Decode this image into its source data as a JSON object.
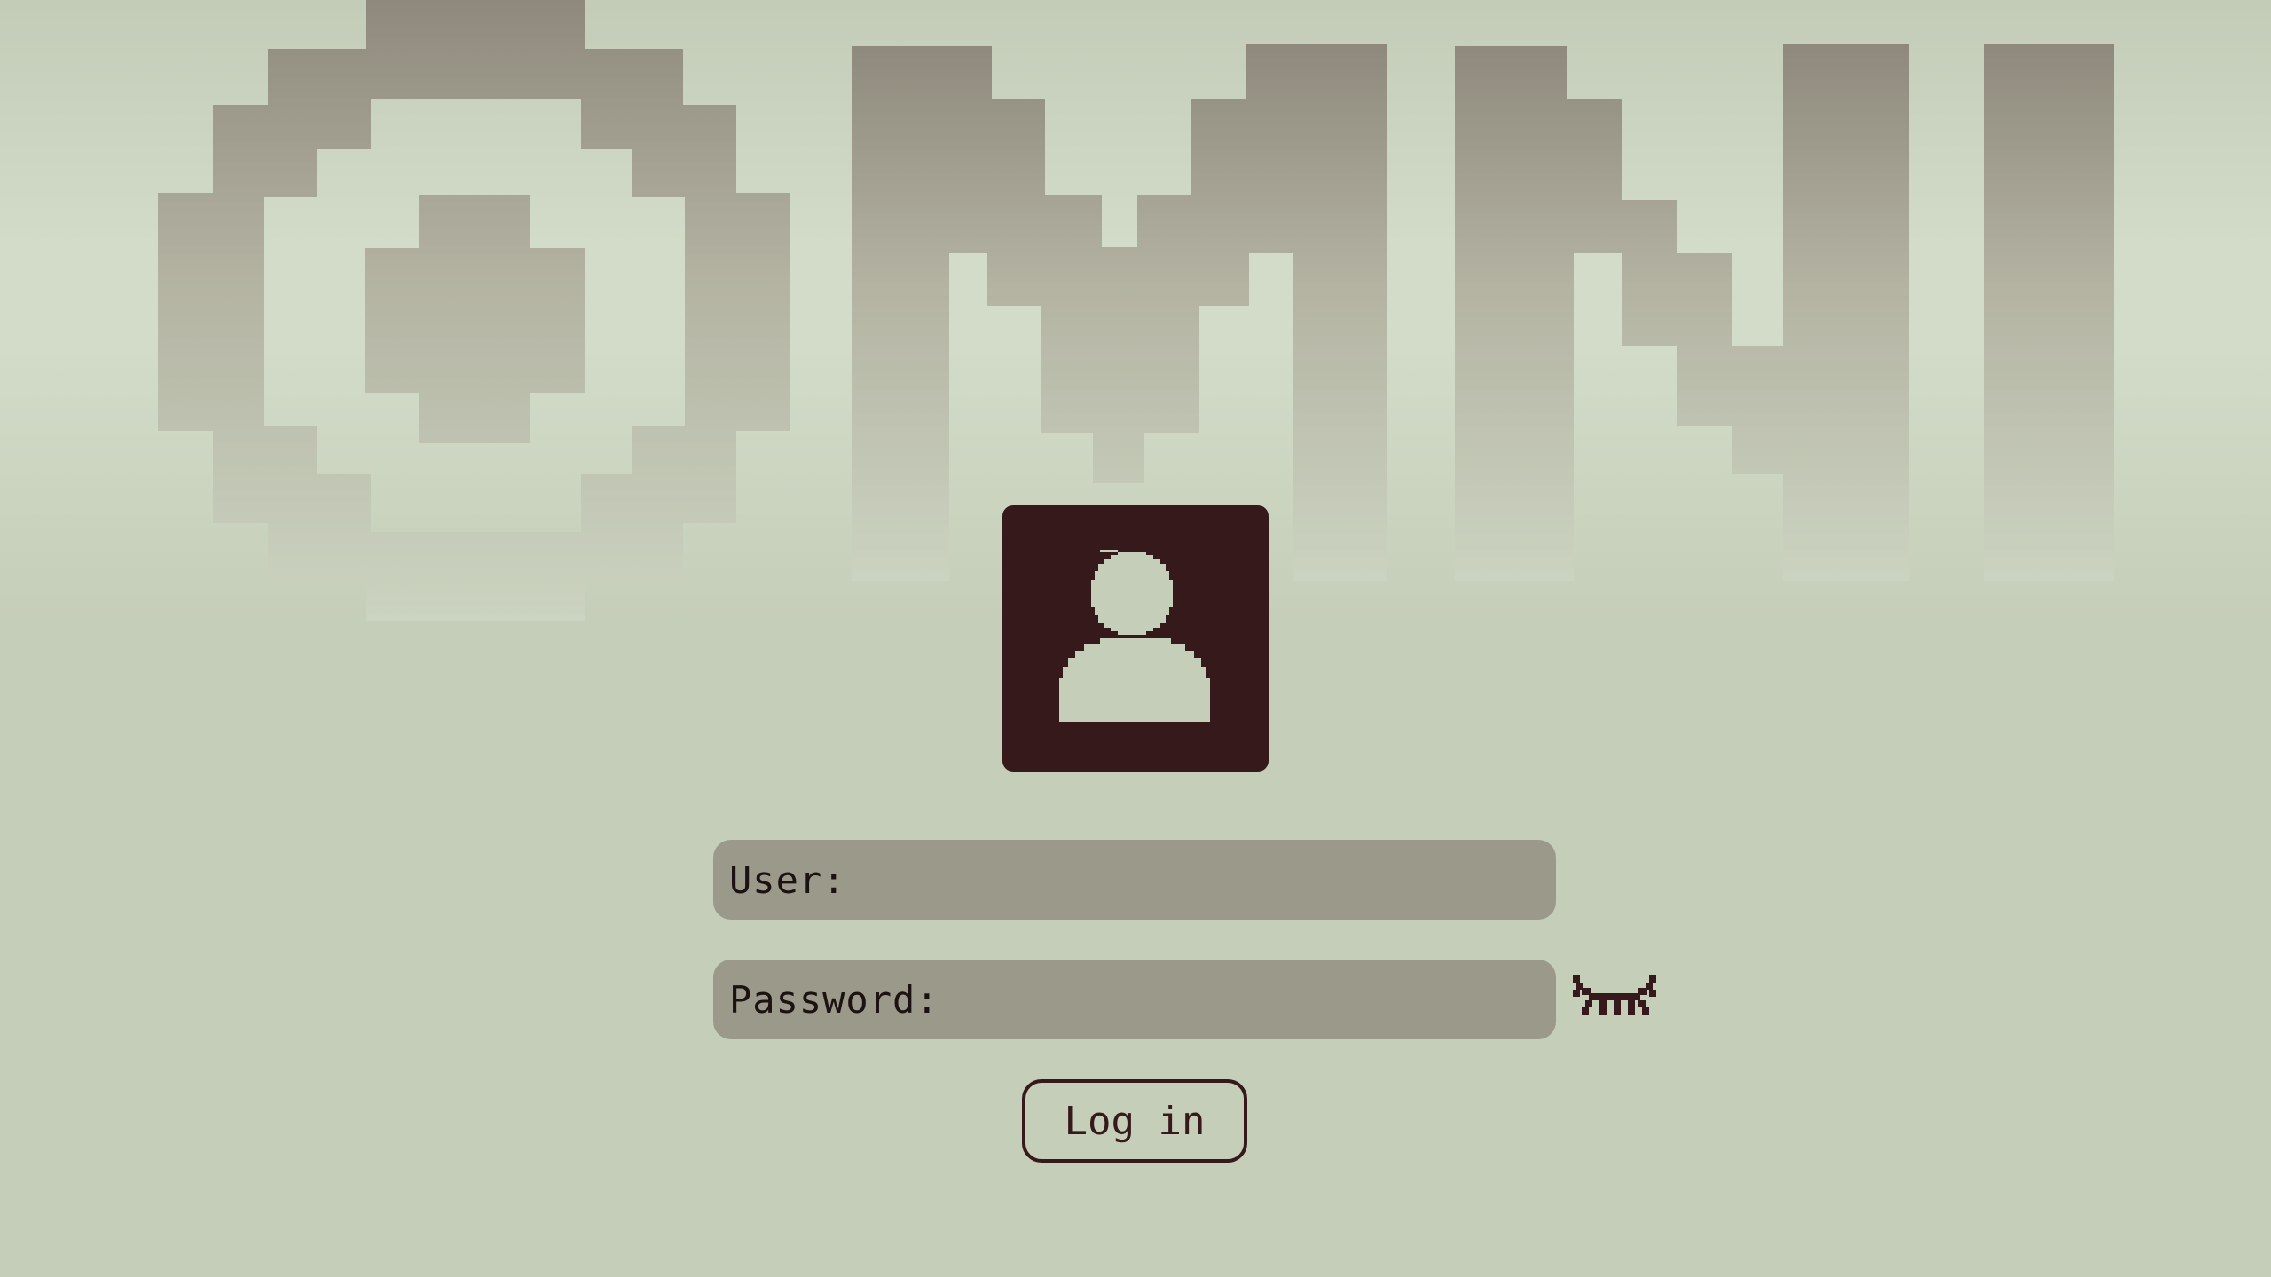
{
  "logo": {
    "text": "OMNI"
  },
  "avatar": {
    "icon": "user-icon",
    "background_color": "#36191a",
    "figure_color": "#c5ceb8"
  },
  "form": {
    "user_label": "User:",
    "user_value": "",
    "password_label": "Password:",
    "password_value": "",
    "password_toggle_icon": "eye-closed-icon",
    "login_label": "Log in"
  },
  "colors": {
    "background": "#c5ceb8",
    "field": "#9b998a",
    "accent": "#36191a"
  }
}
